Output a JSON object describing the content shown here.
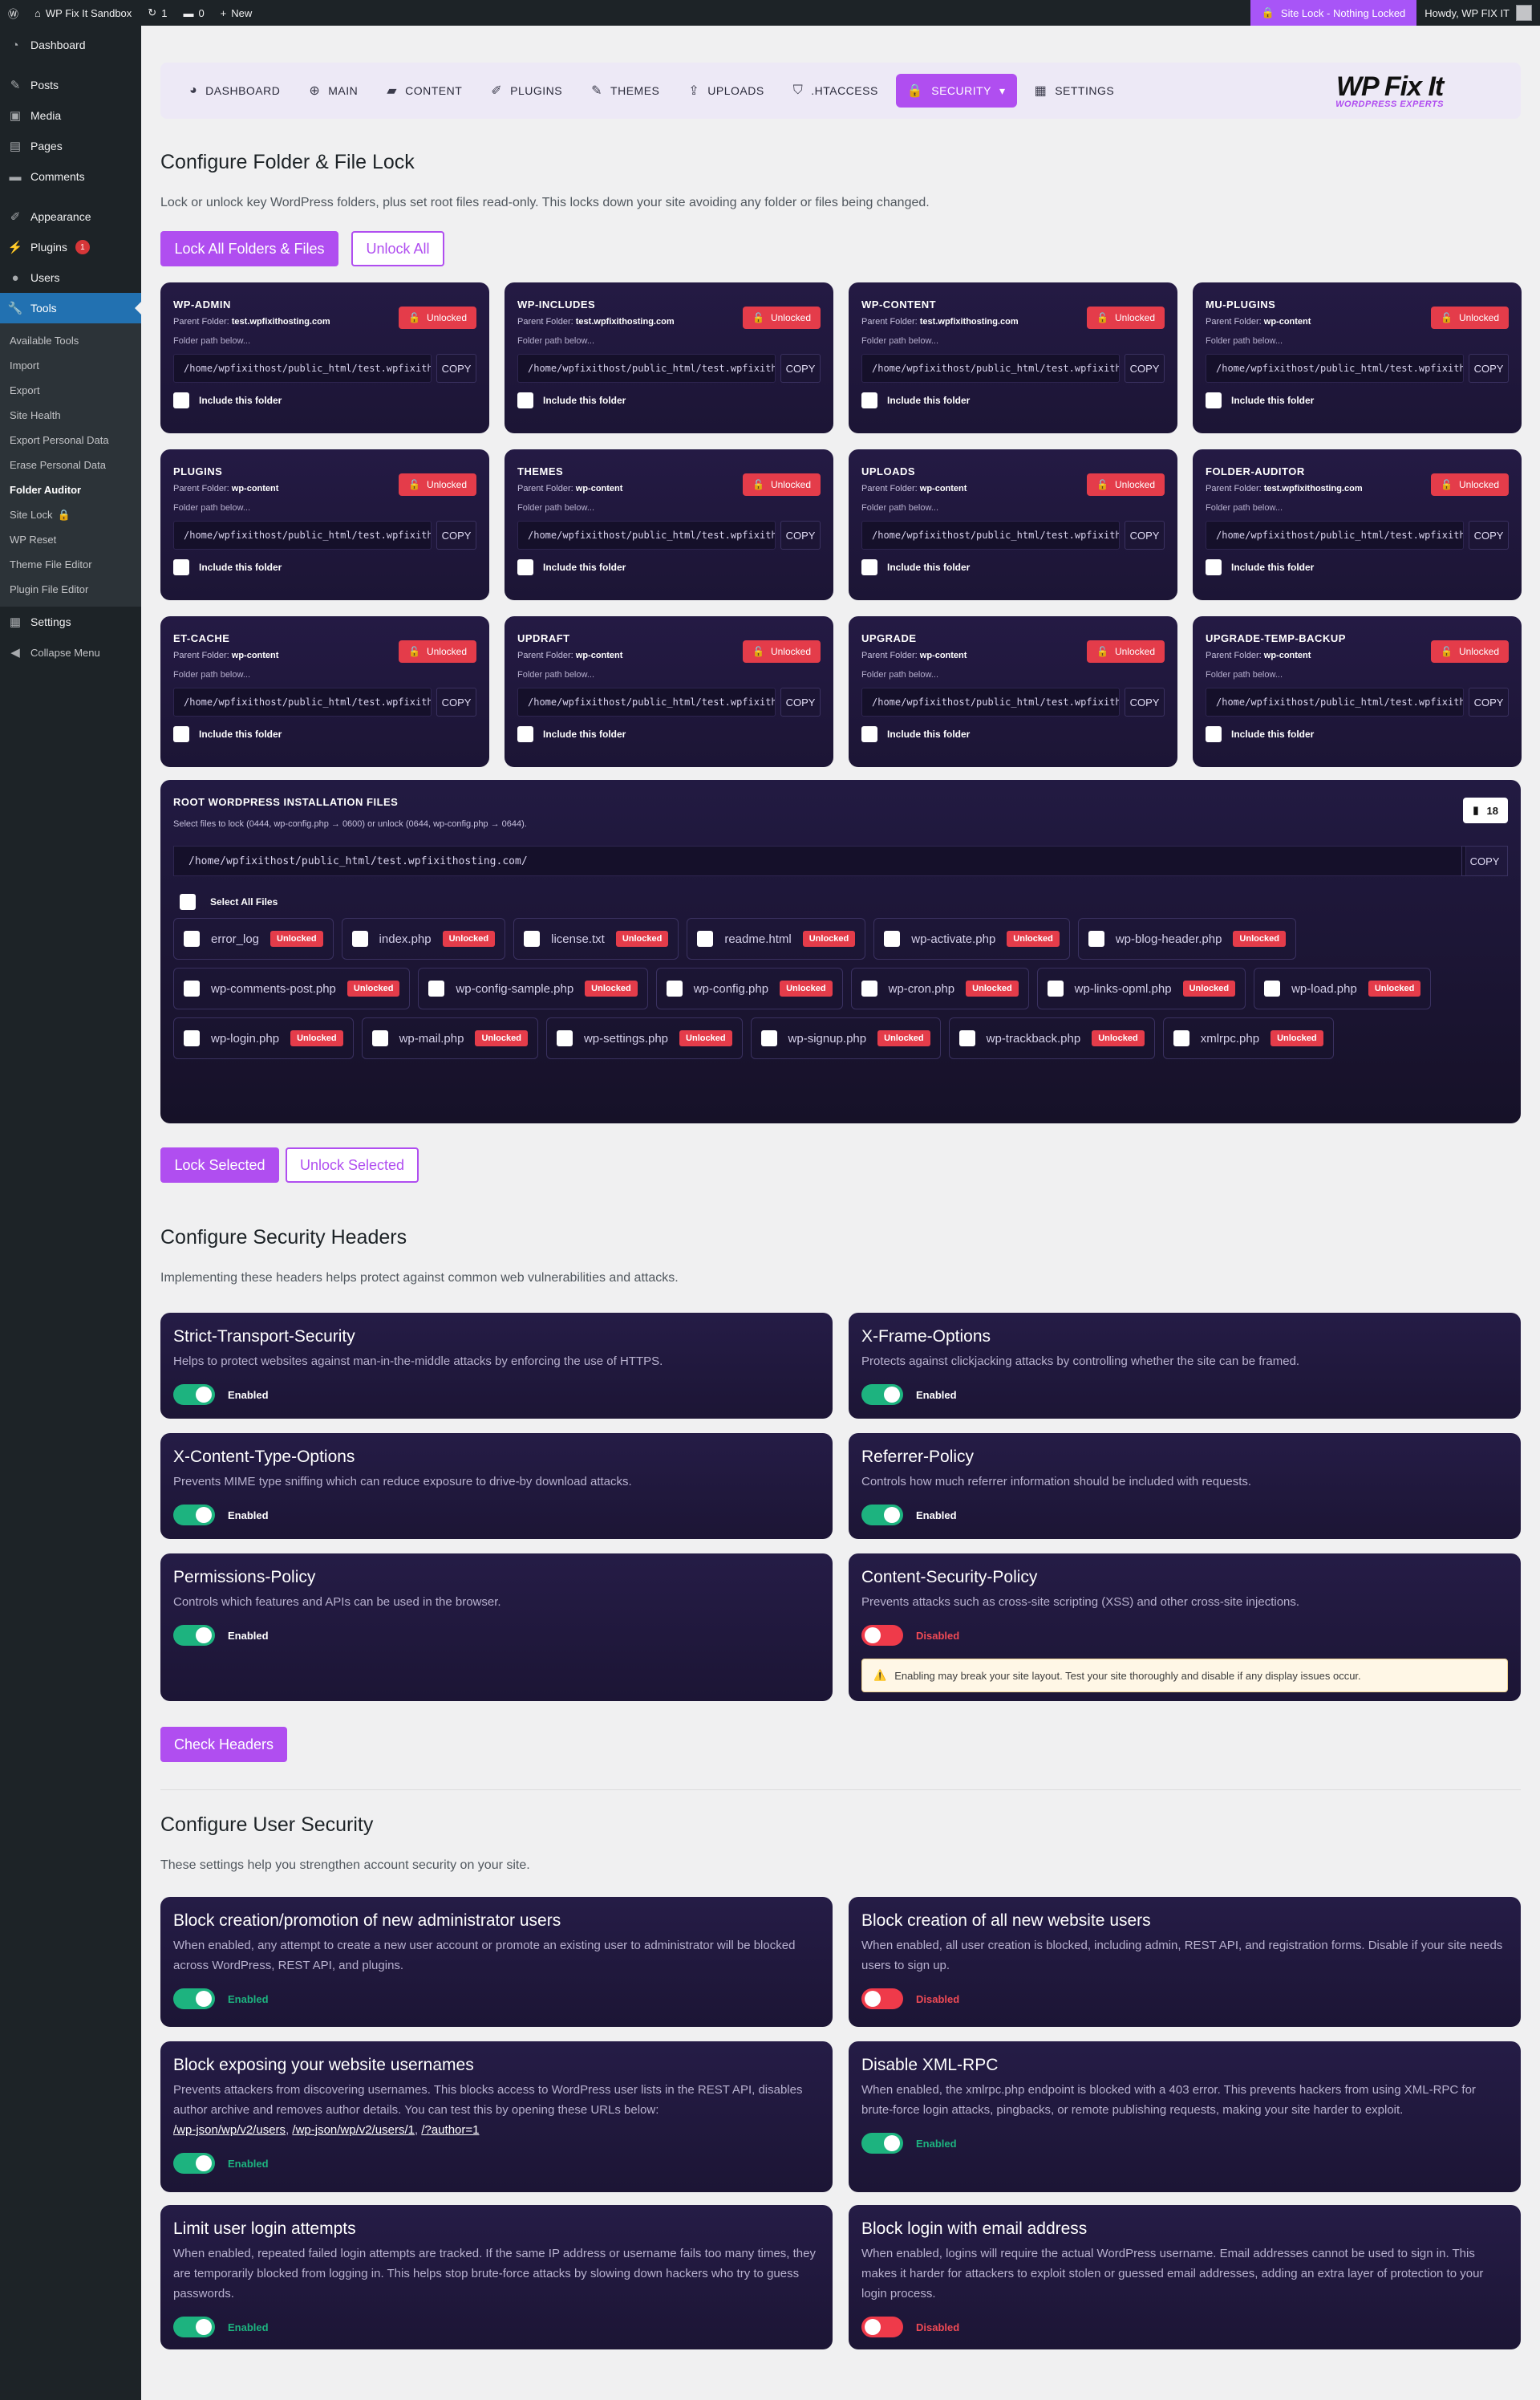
{
  "adminbar": {
    "site_name": "WP Fix It Sandbox",
    "updates": "1",
    "comments": "0",
    "new_label": "New",
    "site_lock": "Site Lock - Nothing Locked",
    "howdy": "Howdy, WP FIX IT"
  },
  "sidebar": {
    "items_top": [
      {
        "label": "Dashboard",
        "icon": "dashboard-icon",
        "glyph": "◔"
      }
    ],
    "items_mid": [
      {
        "label": "Posts",
        "icon": "pin-icon",
        "glyph": "✎"
      },
      {
        "label": "Media",
        "icon": "media-icon",
        "glyph": "▣"
      },
      {
        "label": "Pages",
        "icon": "pages-icon",
        "glyph": "▤"
      },
      {
        "label": "Comments",
        "icon": "comment-icon",
        "glyph": "▬"
      }
    ],
    "items_low": [
      {
        "label": "Appearance",
        "icon": "brush-icon",
        "glyph": "✐"
      },
      {
        "label": "Plugins",
        "icon": "plugin-icon",
        "glyph": "⚡",
        "badge": "1"
      },
      {
        "label": "Users",
        "icon": "users-icon",
        "glyph": "●"
      }
    ],
    "tools_label": "Tools",
    "submenu": [
      "Available Tools",
      "Import",
      "Export",
      "Site Health",
      "Export Personal Data",
      "Erase Personal Data",
      "Folder Auditor",
      "Site Lock",
      "WP Reset",
      "Theme File Editor",
      "Plugin File Editor"
    ],
    "settings": "Settings",
    "collapse": "Collapse Menu"
  },
  "nav": {
    "tabs": [
      {
        "label": "DASHBOARD",
        "glyph": "◕",
        "icon": "dashboard-icon"
      },
      {
        "label": "MAIN",
        "glyph": "⊕",
        "icon": "globe-icon"
      },
      {
        "label": "CONTENT",
        "glyph": "▰",
        "icon": "folder-icon"
      },
      {
        "label": "PLUGINS",
        "glyph": "✐",
        "icon": "plug-icon"
      },
      {
        "label": "THEMES",
        "glyph": "✎",
        "icon": "brush-icon"
      },
      {
        "label": "UPLOADS",
        "glyph": "⇪",
        "icon": "upload-icon"
      },
      {
        "label": ".HTACCESS",
        "glyph": "⛉",
        "icon": "shield-icon"
      },
      {
        "label": "SECURITY",
        "glyph": "🔒",
        "icon": "lock-icon",
        "caret": "▾"
      },
      {
        "label": "SETTINGS",
        "glyph": "▦",
        "icon": "settings-icon"
      }
    ],
    "logo_main": "WP Fix It",
    "logo_sub": "WORDPRESS EXPERTS"
  },
  "lock": {
    "title": "Configure Folder & File Lock",
    "desc": "Lock or unlock key WordPress folders, plus set root files read-only. This locks down your site avoiding any folder or files being changed.",
    "lock_all": "Lock All Folders & Files",
    "unlock_all": "Unlock All",
    "parent_label": "Parent Folder:",
    "path_label": "Folder path below...",
    "copy": "COPY",
    "include": "Include this folder",
    "status": "Unlocked",
    "folders": [
      {
        "name": "WP-ADMIN",
        "parent": "test.wpfixithosting.com",
        "path": "/home/wpfixithost/public_html/test.wpfixithosting.com/wp-admin"
      },
      {
        "name": "WP-INCLUDES",
        "parent": "test.wpfixithosting.com",
        "path": "/home/wpfixithost/public_html/test.wpfixithosting.com/wp-includes"
      },
      {
        "name": "WP-CONTENT",
        "parent": "test.wpfixithosting.com",
        "path": "/home/wpfixithost/public_html/test.wpfixithosting.com/wp-content"
      },
      {
        "name": "MU-PLUGINS",
        "parent": "wp-content",
        "path": "/home/wpfixithost/public_html/test.wpfixithosting.com/wp-content/mu-plugins"
      },
      {
        "name": "PLUGINS",
        "parent": "wp-content",
        "path": "/home/wpfixithost/public_html/test.wpfixithosting.com/wp-content/plugins"
      },
      {
        "name": "THEMES",
        "parent": "wp-content",
        "path": "/home/wpfixithost/public_html/test.wpfixithosting.com/wp-content/themes"
      },
      {
        "name": "UPLOADS",
        "parent": "wp-content",
        "path": "/home/wpfixithost/public_html/test.wpfixithosting.com/wp-content/uploads"
      },
      {
        "name": "FOLDER-AUDITOR",
        "parent": "test.wpfixithosting.com",
        "path": "/home/wpfixithost/public_html/test.wpfixithosting.com/folder-auditor"
      },
      {
        "name": "ET-CACHE",
        "parent": "wp-content",
        "path": "/home/wpfixithost/public_html/test.wpfixithosting.com/wp-content/et-cache"
      },
      {
        "name": "UPDRAFT",
        "parent": "wp-content",
        "path": "/home/wpfixithost/public_html/test.wpfixithosting.com/wp-content/updraft"
      },
      {
        "name": "UPGRADE",
        "parent": "wp-content",
        "path": "/home/wpfixithost/public_html/test.wpfixithosting.com/wp-content/upgrade"
      },
      {
        "name": "UPGRADE-TEMP-BACKUP",
        "parent": "wp-content",
        "path": "/home/wpfixithost/public_html/test.wpfixithosting.com/wp-content/upgrade-temp-backup"
      }
    ]
  },
  "root": {
    "title": "ROOT WORDPRESS INSTALLATION FILES",
    "desc": "Select files to lock (0444, wp-config.php → 0600) or unlock (0644, wp-config.php → 0644).",
    "count": "18",
    "path": "/home/wpfixithost/public_html/test.wpfixithosting.com/",
    "copy": "COPY",
    "select_all": "Select All Files",
    "status": "Unlocked",
    "files": [
      "error_log",
      "index.php",
      "license.txt",
      "readme.html",
      "wp-activate.php",
      "wp-blog-header.php",
      "wp-comments-post.php",
      "wp-config-sample.php",
      "wp-config.php",
      "wp-cron.php",
      "wp-links-opml.php",
      "wp-load.php",
      "wp-login.php",
      "wp-mail.php",
      "wp-settings.php",
      "wp-signup.php",
      "wp-trackback.php",
      "xmlrpc.php"
    ],
    "lock_selected": "Lock Selected",
    "unlock_selected": "Unlock Selected"
  },
  "headers": {
    "title": "Configure Security Headers",
    "desc": "Implementing these headers helps protect against common web vulnerabilities and attacks.",
    "check": "Check Headers",
    "items": [
      {
        "name": "Strict-Transport-Security",
        "desc": "Helps to protect websites against man-in-the-middle attacks by enforcing the use of HTTPS.",
        "state": "Enabled"
      },
      {
        "name": "X-Frame-Options",
        "desc": "Protects against clickjacking attacks by controlling whether the site can be framed.",
        "state": "Enabled"
      },
      {
        "name": "X-Content-Type-Options",
        "desc": "Prevents MIME type sniffing which can reduce exposure to drive-by download attacks.",
        "state": "Enabled"
      },
      {
        "name": "Referrer-Policy",
        "desc": "Controls how much referrer information should be included with requests.",
        "state": "Enabled"
      },
      {
        "name": "Permissions-Policy",
        "desc": "Controls which features and APIs can be used in the browser.",
        "state": "Enabled"
      },
      {
        "name": "Content-Security-Policy",
        "desc": "Prevents attacks such as cross-site scripting (XSS) and other cross-site injections.",
        "state": "Disabled",
        "warning": "Enabling may break your site layout. Test your site thoroughly and disable if any display issues occur."
      }
    ]
  },
  "users": {
    "title": "Configure User Security",
    "desc": "These settings help you strengthen account security on your site.",
    "items": [
      {
        "name": "Block creation/promotion of new administrator users",
        "desc": "When enabled, any attempt to create a new user account or promote an existing user to administrator will be blocked across WordPress, REST API, and plugins.",
        "state": "Enabled"
      },
      {
        "name": "Block creation of all new website users",
        "desc": "When enabled, all user creation is blocked, including admin, REST API, and registration forms. Disable if your site needs users to sign up.",
        "state": "Disabled"
      },
      {
        "name": "Block exposing your website usernames",
        "desc": "Prevents attackers from discovering usernames. This blocks access to WordPress user lists in the REST API, disables author archive and removes author details. You can test this by opening these URLs below:",
        "links": [
          "/wp-json/wp/v2/users",
          "/wp-json/wp/v2/users/1",
          "/?author=1"
        ],
        "state": "Enabled"
      },
      {
        "name": "Disable XML-RPC",
        "desc": "When enabled, the xmlrpc.php endpoint is blocked with a 403 error. This prevents hackers from using XML-RPC for brute-force login attacks, pingbacks, or remote publishing requests, making your site harder to exploit.",
        "state": "Enabled"
      },
      {
        "name": "Limit user login attempts",
        "desc": "When enabled, repeated failed login attempts are tracked. If the same IP address or username fails too many times, they are temporarily blocked from logging in. This helps stop brute-force attacks by slowing down hackers who try to guess passwords.",
        "state": "Enabled"
      },
      {
        "name": "Block login with email address",
        "desc": "When enabled, logins will require the actual WordPress username. Email addresses cannot be used to sign in. This makes it harder for attackers to exploit stolen or guessed email addresses, adding an extra layer of protection to your login process.",
        "state": "Disabled"
      }
    ]
  }
}
